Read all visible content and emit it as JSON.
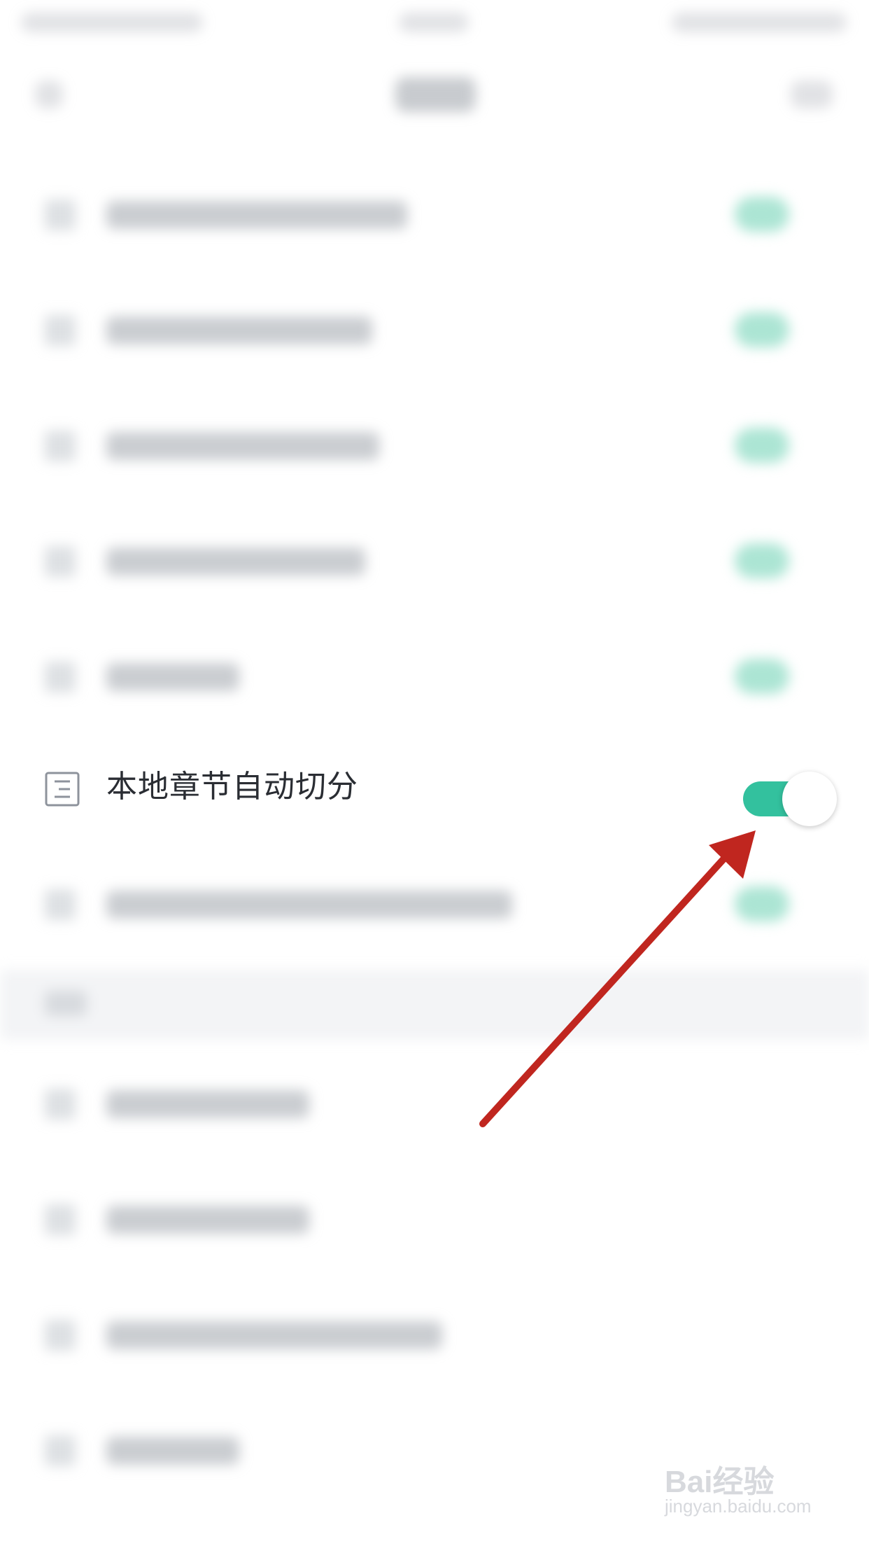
{
  "setting_row": {
    "icon": "document-lines-icon",
    "label": "本地章节自动切分",
    "toggle": {
      "state": "on",
      "on_color": "#33c19e"
    }
  },
  "blurred_rows_above": 5,
  "blurred_rows_below": 5,
  "annotation": {
    "arrow_color": "#c0261f",
    "points_to": "toggle"
  },
  "watermark": {
    "brand": "Bai经验",
    "url": "jingyan.baidu.com"
  }
}
